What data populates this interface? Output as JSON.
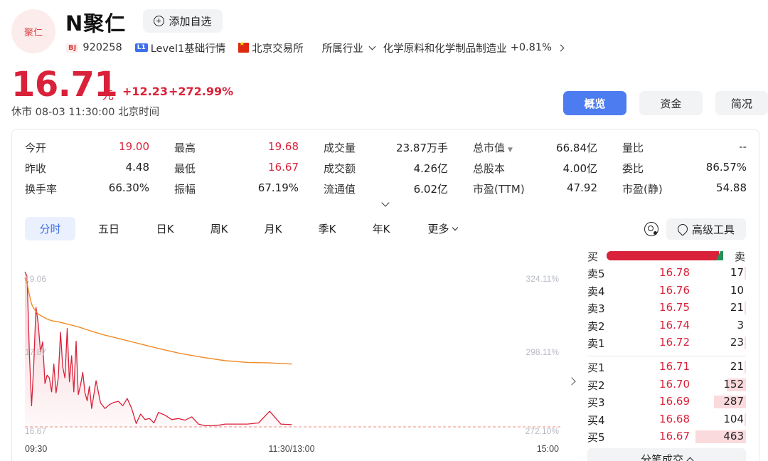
{
  "header": {
    "avatar_text": "聚仁",
    "name": "N聚仁",
    "add_watch": "添加自选",
    "market_tag": "BJ",
    "code": "920258",
    "level_tag": "L1",
    "level_text": "Level1基础行情",
    "exchange": "北京交易所",
    "industry_label": "所属行业",
    "industry": "化学原料和化学制品制造业",
    "industry_change": "+0.81%"
  },
  "price": {
    "last": "16.71",
    "unit": "元",
    "change": "+12.23",
    "change_pct": "+272.99%",
    "status": "休市 08-03 11:30:00 北京时间"
  },
  "top_tabs": [
    "概览",
    "资金",
    "简况"
  ],
  "quote_grid": [
    [
      {
        "label": "今开",
        "value": "19.00",
        "color": "red"
      },
      {
        "label": "最高",
        "value": "19.68",
        "color": "red"
      },
      {
        "label": "成交量",
        "value": "23.87万手"
      },
      {
        "label": "总市值",
        "value": "66.84亿"
      },
      {
        "label": "量比",
        "value": "--"
      }
    ],
    [
      {
        "label": "昨收",
        "value": "4.48"
      },
      {
        "label": "最低",
        "value": "16.67",
        "color": "red"
      },
      {
        "label": "成交额",
        "value": "4.26亿"
      },
      {
        "label": "总股本",
        "value": "4.00亿"
      },
      {
        "label": "委比",
        "value": "86.57%"
      }
    ],
    [
      {
        "label": "换手率",
        "value": "66.30%"
      },
      {
        "label": "振幅",
        "value": "67.19%"
      },
      {
        "label": "流通值",
        "value": "6.02亿"
      },
      {
        "label": "市盈(TTM)",
        "value": "47.92"
      },
      {
        "label": "市盈(静)",
        "value": "54.88"
      }
    ]
  ],
  "period_tabs": [
    "分时",
    "五日",
    "日K",
    "周K",
    "月K",
    "季K",
    "年K",
    "更多"
  ],
  "adv_tools": "高级工具",
  "chart_axes": {
    "y_left_top": "19.06",
    "y_left_mid": "17.87",
    "y_left_bottom": "16.67",
    "y_right_top": "324.11%",
    "y_right_mid": "298.11%",
    "y_right_bottom": "272.10%",
    "x_start": "09:30",
    "x_mid": "11:30/13:00",
    "x_end": "15:00"
  },
  "chart_data": {
    "type": "line",
    "ylim": [
      16.67,
      19.46
    ],
    "x_total_minutes": 240,
    "series": [
      {
        "color": "#d9223a",
        "x": [
          0,
          1,
          2,
          3,
          4,
          5,
          6,
          7,
          8,
          9,
          10,
          11,
          12,
          13,
          14,
          15,
          16,
          17,
          18,
          19,
          20,
          21,
          22,
          23,
          24,
          25,
          26,
          27,
          28,
          29,
          30,
          32,
          34,
          36,
          38,
          40,
          42,
          44,
          46,
          48,
          50,
          52,
          54,
          56,
          58,
          60,
          63,
          66,
          69,
          72,
          75,
          78,
          81,
          84,
          87,
          90,
          95,
          100,
          105,
          110,
          115,
          120
        ],
        "values": [
          19.46,
          19.38,
          18.0,
          17.05,
          17.8,
          18.82,
          18.52,
          18.02,
          18.2,
          17.45,
          17.6,
          17.55,
          17.3,
          17.8,
          17.28,
          17.55,
          18.37,
          17.75,
          17.55,
          18.44,
          17.48,
          17.95,
          17.3,
          18.21,
          17.25,
          17.42,
          17.65,
          17.28,
          17.14,
          17.4,
          17.0,
          17.5,
          17.1,
          17.0,
          17.07,
          17.11,
          17.13,
          17.05,
          17.18,
          17.0,
          16.73,
          16.9,
          16.8,
          16.82,
          16.74,
          16.93,
          16.88,
          16.8,
          16.82,
          16.79,
          16.85,
          16.72,
          16.69,
          16.69,
          16.7,
          16.72,
          16.72,
          16.72,
          16.74,
          16.95,
          16.72,
          16.71
        ]
      },
      {
        "color": "#f08a24",
        "x": [
          0,
          1,
          2,
          3,
          4,
          5,
          6,
          8,
          10,
          12,
          15,
          18,
          21,
          24,
          27,
          30,
          35,
          40,
          45,
          50,
          55,
          60,
          70,
          80,
          90,
          100,
          110,
          120
        ],
        "values": [
          19.35,
          19.25,
          19.05,
          18.88,
          18.8,
          18.75,
          18.7,
          18.65,
          18.61,
          18.58,
          18.56,
          18.53,
          18.5,
          18.47,
          18.43,
          18.39,
          18.33,
          18.28,
          18.23,
          18.18,
          18.13,
          18.08,
          17.99,
          17.92,
          17.86,
          17.83,
          17.82,
          17.8
        ]
      }
    ]
  },
  "order_book": {
    "buy_label": "买",
    "sell_label": "卖",
    "buy_ratio": 0.94,
    "asks": [
      {
        "label": "卖5",
        "price": "16.78",
        "volume": "17",
        "bar": 0.01
      },
      {
        "label": "卖4",
        "price": "16.76",
        "volume": "10",
        "bar": 0.0
      },
      {
        "label": "卖3",
        "price": "16.75",
        "volume": "21",
        "bar": 0.01
      },
      {
        "label": "卖2",
        "price": "16.74",
        "volume": "3",
        "bar": 0.0
      },
      {
        "label": "卖1",
        "price": "16.72",
        "volume": "23",
        "bar": 0.01
      }
    ],
    "bids": [
      {
        "label": "买1",
        "price": "16.71",
        "volume": "21",
        "bar": 0.01
      },
      {
        "label": "买2",
        "price": "16.70",
        "volume": "152",
        "bar": 0.12
      },
      {
        "label": "买3",
        "price": "16.69",
        "volume": "287",
        "bar": 0.2
      },
      {
        "label": "买4",
        "price": "16.68",
        "volume": "104",
        "bar": 0.01
      },
      {
        "label": "买5",
        "price": "16.67",
        "volume": "463",
        "bar": 0.32
      }
    ],
    "trades_button": "分笔成交"
  }
}
